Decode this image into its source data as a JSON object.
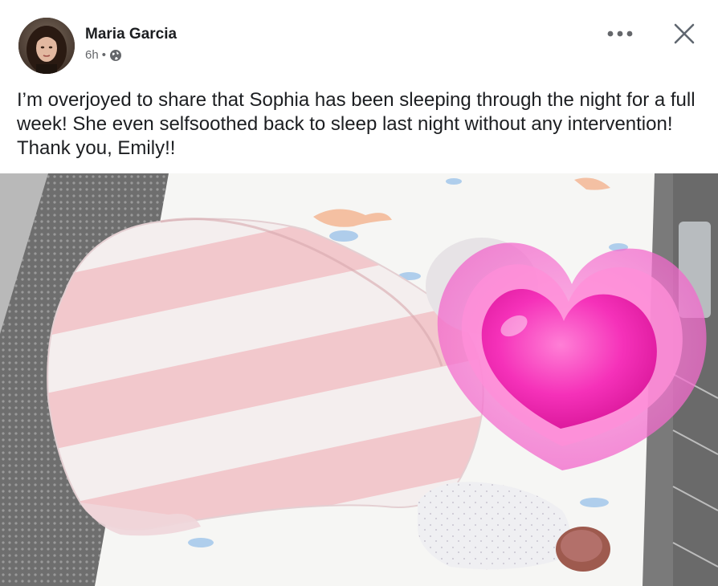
{
  "post": {
    "author": "Maria Garcia",
    "time": "6h",
    "separator": "•",
    "audience_icon": "globe-icon",
    "text": "I’m overjoyed to share that Sophia has been sleeping through the night for a full week! She even selfsoothed back to sleep last night without any intervention! Thank you, Emily!!",
    "photo_alt": "Baby sleeping in a crib in a pink and white striped sleep sack, face covered by a pink heart emoji"
  },
  "controls": {
    "more_icon": "more-horizontal-icon",
    "close_icon": "close-icon"
  },
  "colors": {
    "text": "#1c1e21",
    "secondary": "#65676b",
    "heart": "#ff2fb3"
  }
}
